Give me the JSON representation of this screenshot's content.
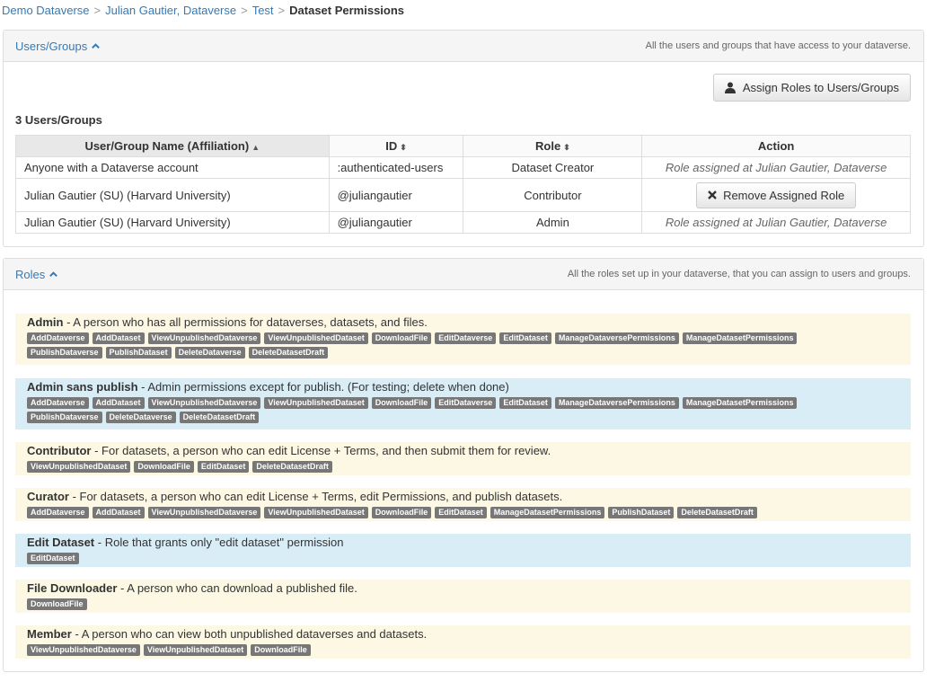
{
  "breadcrumb": {
    "items": [
      "Demo Dataverse",
      "Julian Gautier, Dataverse",
      "Test"
    ],
    "current": "Dataset Permissions",
    "separator": ">"
  },
  "users_panel": {
    "title": "Users/Groups",
    "description": "All the users and groups that have access to your dataverse.",
    "assign_button": "Assign Roles to Users/Groups",
    "count": "3 Users/Groups",
    "columns": [
      "User/Group Name (Affiliation)",
      "ID",
      "Role",
      "Action"
    ],
    "rows": [
      {
        "name": "Anyone with a Dataverse account",
        "id": ":authenticated-users",
        "role": "Dataset Creator",
        "action": "Role assigned at Julian Gautier, Dataverse",
        "action_type": "text"
      },
      {
        "name": "Julian Gautier (SU) (Harvard University)",
        "id": "@juliangautier",
        "role": "Contributor",
        "action": "Remove Assigned Role",
        "action_type": "button"
      },
      {
        "name": "Julian Gautier (SU) (Harvard University)",
        "id": "@juliangautier",
        "role": "Admin",
        "action": "Role assigned at Julian Gautier, Dataverse",
        "action_type": "text"
      }
    ]
  },
  "roles_panel": {
    "title": "Roles",
    "description": "All the roles set up in your dataverse, that you can assign to users and groups.",
    "roles": [
      {
        "name": "Admin",
        "desc": "A person who has all permissions for dataverses, datasets, and files.",
        "color": "yellow",
        "perms": [
          "AddDataverse",
          "AddDataset",
          "ViewUnpublishedDataverse",
          "ViewUnpublishedDataset",
          "DownloadFile",
          "EditDataverse",
          "EditDataset",
          "ManageDataversePermissions",
          "ManageDatasetPermissions",
          "PublishDataverse",
          "PublishDataset",
          "DeleteDataverse",
          "DeleteDatasetDraft"
        ]
      },
      {
        "name": "Admin sans publish",
        "desc": "Admin permissions except for publish. (For testing; delete when done)",
        "color": "blue",
        "perms": [
          "AddDataverse",
          "AddDataset",
          "ViewUnpublishedDataverse",
          "ViewUnpublishedDataset",
          "DownloadFile",
          "EditDataverse",
          "EditDataset",
          "ManageDataversePermissions",
          "ManageDatasetPermissions",
          "PublishDataverse",
          "DeleteDataverse",
          "DeleteDatasetDraft"
        ]
      },
      {
        "name": "Contributor",
        "desc": "For datasets, a person who can edit License + Terms, and then submit them for review.",
        "color": "yellow",
        "perms": [
          "ViewUnpublishedDataset",
          "DownloadFile",
          "EditDataset",
          "DeleteDatasetDraft"
        ]
      },
      {
        "name": "Curator",
        "desc": "For datasets, a person who can edit License + Terms, edit Permissions, and publish datasets.",
        "color": "yellow",
        "perms": [
          "AddDataverse",
          "AddDataset",
          "ViewUnpublishedDataverse",
          "ViewUnpublishedDataset",
          "DownloadFile",
          "EditDataset",
          "ManageDatasetPermissions",
          "PublishDataset",
          "DeleteDatasetDraft"
        ]
      },
      {
        "name": "Edit Dataset",
        "desc": "Role that grants only \"edit dataset\" permission",
        "color": "blue",
        "perms": [
          "EditDataset"
        ]
      },
      {
        "name": "File Downloader",
        "desc": "A person who can download a published file.",
        "color": "yellow",
        "perms": [
          "DownloadFile"
        ]
      },
      {
        "name": "Member",
        "desc": "A person who can view both unpublished dataverses and datasets.",
        "color": "yellow",
        "perms": [
          "ViewUnpublishedDataverse",
          "ViewUnpublishedDataset",
          "DownloadFile"
        ]
      }
    ]
  }
}
